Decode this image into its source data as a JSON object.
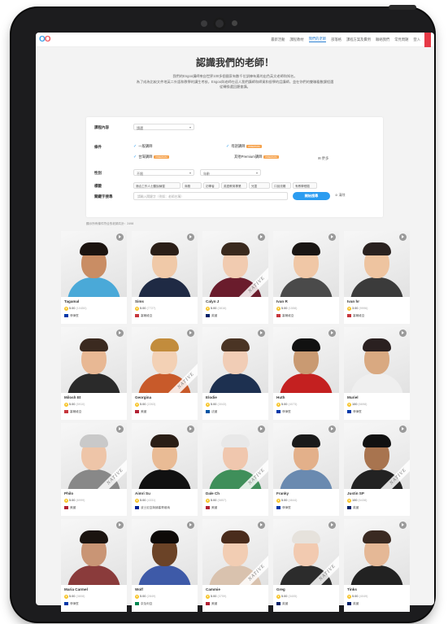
{
  "nav": {
    "logo_a": "O",
    "logo_b": "O",
    "items": [
      "最新活動",
      "課程教材",
      "我們的老師",
      "部落格",
      "課程方案及費用",
      "聯絡我們",
      "常見問題",
      "登入"
    ],
    "active_index": 2
  },
  "header": {
    "title": "認識我們的老師！",
    "intro": "我們的Engoo講師來自世界100多個國家有數千位訓練有素的出色英文老師和知名。\n為了成為比較文件地英二外語和教學的講生考核，Engoo與老師在這人我們講師和師資和很學的話講師，並在你們的雙聯看數課程選\n從轉換選回聽會講。"
  },
  "filters": {
    "lesson_material_label": "課程內容",
    "lesson_material_value": "請選",
    "options_label": "條件",
    "opt_general": "一般講師",
    "opt_native": "母語講師",
    "opt_native_badge": "PREMIUM",
    "opt_taiwan": "台灣講師",
    "opt_taiwan_badge": "PREMIUM",
    "opt_premium": "其他Premium講師",
    "opt_premium_badge": "PREMIUM",
    "opt_more": "更多",
    "gender_label": "性別",
    "gender_value": "不限",
    "age_value": "年齡",
    "tags_label": "標籤",
    "tags": [
      "適合工作人士聽說練習",
      "商務",
      "初學者",
      "英語教育專業",
      "兒童",
      "口說流暢",
      "有教學經驗"
    ],
    "keyword_label": "關鍵字搜尋",
    "keyword_placeholder": "請輸入關鍵字（例如：老師名稱）",
    "search_button": "開始搜尋",
    "reset": "清除"
  },
  "result_count": "顯示所有條件符合的老師共計：2498",
  "teachers": [
    {
      "name": "Tagamal",
      "rating": "5.00",
      "count": "(10450)",
      "country": "菲律賓",
      "native": false
    },
    {
      "name": "Sims",
      "rating": "5.00",
      "count": "(7727)",
      "country": "塞爾維亞",
      "native": false
    },
    {
      "name": "Calyn J",
      "rating": "5.00",
      "count": "(3816)",
      "country": "英國",
      "native": true
    },
    {
      "name": "Ivan R",
      "rating": "5.00",
      "count": "(1558)",
      "country": "塞爾維亞",
      "native": false
    },
    {
      "name": "Ivan hr",
      "rating": "3.00",
      "count": "(9996)",
      "country": "塞爾維亞",
      "native": false
    },
    {
      "name": "Milosh Et",
      "rating": "5.00",
      "count": "(5910)",
      "country": "塞爾維亞",
      "native": false
    },
    {
      "name": "Georgina",
      "rating": "5.00",
      "count": "(2263)",
      "country": "美國",
      "native": true
    },
    {
      "name": "Elodie",
      "rating": "5.00",
      "count": "(3043)",
      "country": "法國",
      "native": false
    },
    {
      "name": "Huth",
      "rating": "5.00",
      "count": "(4073)",
      "country": "菲律賓",
      "native": false
    },
    {
      "name": "Muriel",
      "rating": "100",
      "count": "(6698)",
      "country": "菲律賓",
      "native": false
    },
    {
      "name": "Philo",
      "rating": "5.00",
      "count": "(6999)",
      "country": "美國",
      "native": true
    },
    {
      "name": "Aimri Su",
      "rating": "5.00",
      "count": "(4331)",
      "country": "波士尼亞與赫塞哥維納",
      "native": false
    },
    {
      "name": "Dale Ch",
      "rating": "5.00",
      "count": "(5857)",
      "country": "美國",
      "native": true
    },
    {
      "name": "Franky",
      "rating": "5.00",
      "count": "(4644)",
      "country": "菲律賓",
      "native": false
    },
    {
      "name": "Justin SP",
      "rating": "100",
      "count": "(6438)",
      "country": "英國",
      "native": true
    },
    {
      "name": "Maria Carmel",
      "rating": "5.00",
      "count": "(3808)",
      "country": "菲律賓",
      "native": false
    },
    {
      "name": "Wolf",
      "rating": "5.00",
      "count": "(2849)",
      "country": "奈及利亞",
      "native": false
    },
    {
      "name": "Cammie",
      "rating": "5.00",
      "count": "(3759)",
      "country": "美國",
      "native": true
    },
    {
      "name": "Greg",
      "rating": "5.00",
      "count": "(3405)",
      "country": "英國",
      "native": true
    },
    {
      "name": "Tinks",
      "rating": "5.00",
      "count": "(4049)",
      "country": "英國",
      "native": false
    }
  ],
  "native_label": "NATIVE",
  "colors": {
    "accent": "#2b9cf0",
    "badge": "#f6a14a",
    "nav_red": "#e63946",
    "star": "#f7c52b"
  }
}
